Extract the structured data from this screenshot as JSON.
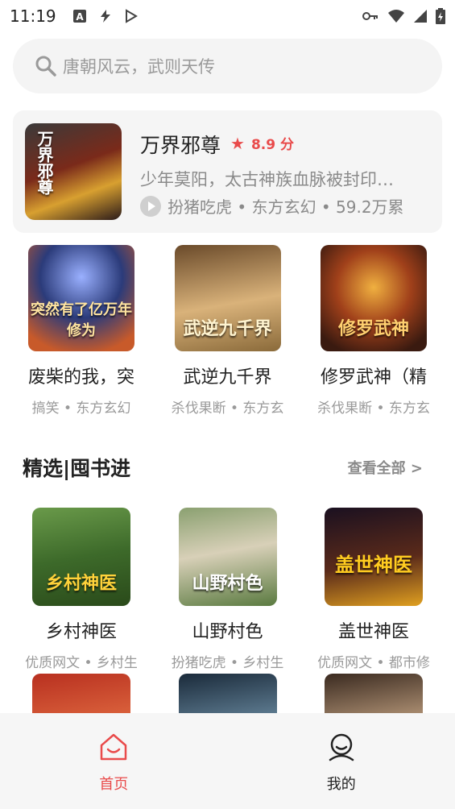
{
  "status_bar": {
    "time": "11:19",
    "left_icons": [
      "a-icon",
      "signal-bolt-icon",
      "play-store-icon"
    ],
    "right_icons": [
      "key-icon",
      "wifi-icon",
      "cellular-icon",
      "battery-icon"
    ]
  },
  "search": {
    "placeholder": "唐朝风云，武则天传"
  },
  "featured": {
    "title": "万界邪尊",
    "rating": "8.9 分",
    "description": "少年莫阳，太古神族血脉被封印…",
    "meta": "扮猪吃虎 • 东方玄幻 • 59.2万累",
    "cover_text": "万界邪尊"
  },
  "top_books": [
    {
      "title": "废柴的我，突",
      "sub": "搞笑 • 东方玄幻",
      "cover_text": "突然有了亿万年修为",
      "colors": [
        "#2b3b7a",
        "#c85a2a"
      ]
    },
    {
      "title": "武逆九千界",
      "sub": "杀伐果断 • 东方玄",
      "cover_text": "武逆九千界",
      "colors": [
        "#8a6a3a",
        "#d9b27a"
      ]
    },
    {
      "title": "修罗武神（精",
      "sub": "杀伐果断 • 东方玄",
      "cover_text": "修罗武神",
      "colors": [
        "#3a1a10",
        "#e8902a"
      ]
    }
  ],
  "section": {
    "title": "精选|囤书进",
    "view_all": "查看全部 >"
  },
  "picks": [
    {
      "title": "乡村神医",
      "sub": "优质网文 • 乡村生",
      "cover_text": "乡村神医",
      "colors": [
        "#3d6a2a",
        "#c8a020"
      ]
    },
    {
      "title": "山野村色",
      "sub": "扮猪吃虎 • 乡村生",
      "cover_text": "山野村色",
      "colors": [
        "#5a7a40",
        "#d8d0b8"
      ]
    },
    {
      "title": "盖世神医",
      "sub": "优质网文 • 都市修",
      "cover_text": "盖世神医",
      "colors": [
        "#2a1a2a",
        "#e0a020"
      ]
    }
  ],
  "picks_row2": [
    {
      "colors": [
        "#b83020",
        "#e06a40"
      ]
    },
    {
      "colors": [
        "#1a2a3a",
        "#6a8aa0"
      ]
    },
    {
      "colors": [
        "#3a2a20",
        "#c0a080"
      ]
    }
  ],
  "bottom_nav": {
    "home_label": "首页",
    "me_label": "我的"
  },
  "colors": {
    "accent": "#e94b4b"
  }
}
